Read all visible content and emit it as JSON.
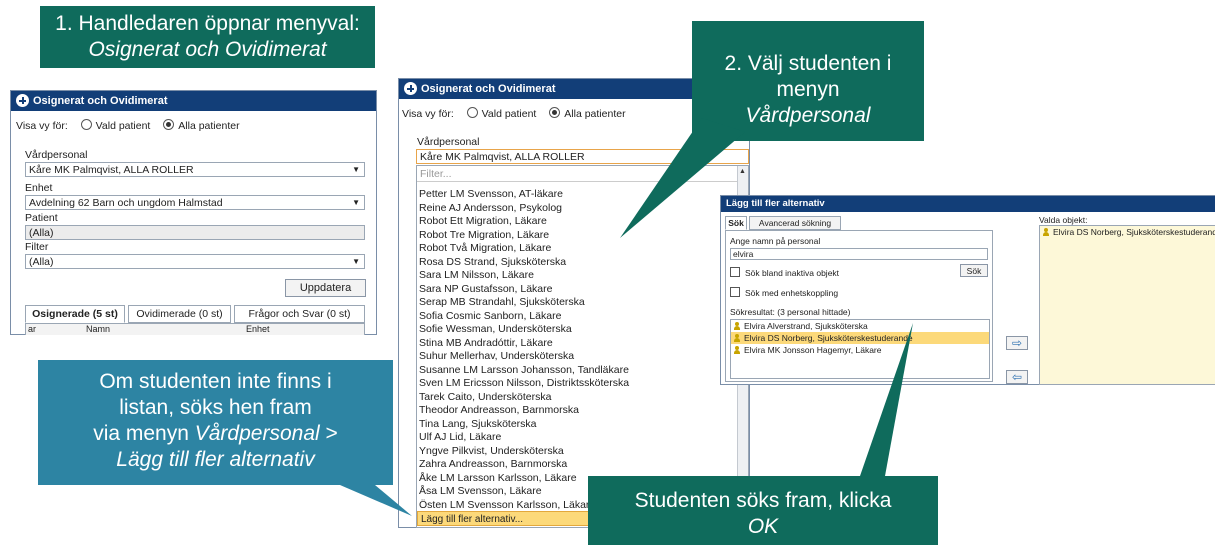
{
  "callouts": {
    "step1_line1": "1. Handledaren öppnar menyval:",
    "step1_line2": "Osignerat och Ovidimerat",
    "step2_line1": "2. Välj studenten i menyn",
    "step2_line2": "Vårdpersonal",
    "note_line1": "Om studenten inte finns i",
    "note_line2": "listan, söks hen fram",
    "note_line3_a": "via menyn ",
    "note_line3_b": "Vårdpersonal",
    "note_line3_c": " >",
    "note_line4": "Lägg till fler alternativ",
    "step3_line1": "Studenten söks fram, klicka",
    "step3_line2": "OK"
  },
  "win1": {
    "title": "Osignerat och Ovidimerat",
    "visa_label": "Visa vy för:",
    "radio_vald": "Vald patient",
    "radio_alla": "Alla patienter",
    "vardpersonal_label": "Vårdpersonal",
    "vardpersonal_value": "Kåre MK Palmqvist, ALLA ROLLER",
    "enhet_label": "Enhet",
    "enhet_value": "Avdelning 62 Barn och ungdom Halmstad",
    "patient_label": "Patient",
    "patient_value": "(Alla)",
    "filter_label": "Filter",
    "filter_value": "(Alla)",
    "update_button": "Uppdatera",
    "tabs": [
      "Osignerade  (5 st)",
      "Ovidimerade  (0 st)",
      "Frågor och Svar  (0 st)"
    ],
    "columns": [
      "ar",
      "Namn",
      "Enhet"
    ]
  },
  "win2": {
    "title": "Osignerat och Ovidimerat",
    "visa_label": "Visa vy för:",
    "radio_vald": "Vald patient",
    "radio_alla": "Alla patienter",
    "vardpersonal_label": "Vårdpersonal",
    "vardpersonal_value": "Kåre MK Palmqvist, ALLA ROLLER",
    "filter_placeholder": "Filter...",
    "items": [
      "Petter LM Svensson, AT-läkare",
      "Reine AJ Andersson, Psykolog",
      "Robot Ett Migration, Läkare",
      "Robot Tre Migration, Läkare",
      "Robot Två Migration, Läkare",
      "Rosa DS Strand, Sjuksköterska",
      "Sara LM Nilsson, Läkare",
      "Sara NP Gustafsson, Läkare",
      "Serap MB Strandahl, Sjuksköterska",
      "Sofia Cosmic Sanborn, Läkare",
      "Sofie Wessman, Undersköterska",
      "Stina MB Andradóttir, Läkare",
      "Suhur Mellerhav, Undersköterska",
      "Susanne LM Larsson Johansson, Tandläkare",
      "Sven LM Ericsson Nilsson, Distriktssköterska",
      "Tarek Caito, Undersköterska",
      "Theodor Andreasson, Barnmorska",
      "Tina Lang, Sjuksköterska",
      "Ulf AJ Lid, Läkare",
      "Yngve Pilkvist, Undersköterska",
      "Zahra Andreasson, Barnmorska",
      "Åke LM Larsson Karlsson, Läkare",
      "Åsa LM Svensson, Läkare",
      "Östen LM Svensson Karlsson, Läkare"
    ],
    "add_more": "Lägg till fler alternativ..."
  },
  "win3": {
    "title": "Lägg till fler alternativ",
    "tab_sok": "Sök",
    "tab_avancerad": "Avancerad sökning",
    "name_label": "Ange namn på personal",
    "name_value": "elvira",
    "chk_inactive": "Sök bland inaktiva objekt",
    "search_button": "Sök",
    "chk_unit": "Sök med enhetskoppling",
    "results_label": "Sökresultat: (3 personal hittade)",
    "results": [
      "Elvira Alverstrand, Sjuksköterska",
      "Elvira DS Norberg, Sjuksköterskestuderande",
      "Elvira MK Jonsson Hagemyr, Läkare"
    ],
    "selected_label": "Valda objekt:",
    "selected": [
      "Elvira DS Norberg, Sjuksköterskestuderande"
    ]
  },
  "colors": {
    "callout_green": "#0f6b5c",
    "callout_teal": "#2d84a3",
    "title_bar": "#123e78",
    "highlight": "#fcd97a"
  }
}
